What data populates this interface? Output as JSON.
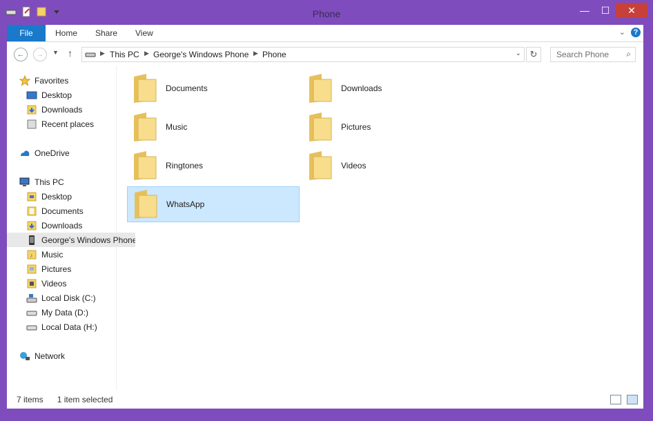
{
  "window": {
    "title": "Phone"
  },
  "ribbon": {
    "tabs": [
      "File",
      "Home",
      "Share",
      "View"
    ],
    "help": "?"
  },
  "address": {
    "segments": [
      "This PC",
      "George's Windows Phone",
      "Phone"
    ]
  },
  "search": {
    "placeholder": "Search Phone"
  },
  "nav": {
    "favorites": "Favorites",
    "fav_items": [
      "Desktop",
      "Downloads",
      "Recent places"
    ],
    "onedrive": "OneDrive",
    "thispc": "This PC",
    "pc_items": [
      "Desktop",
      "Documents",
      "Downloads",
      "George's Windows Phone",
      "Music",
      "Pictures",
      "Videos",
      "Local Disk (C:)",
      "My Data (D:)",
      "Local Data  (H:)"
    ],
    "network": "Network"
  },
  "folders": [
    "Documents",
    "Downloads",
    "Music",
    "Pictures",
    "Ringtones",
    "Videos",
    "WhatsApp"
  ],
  "status": {
    "count": "7 items",
    "selected": "1 item selected"
  },
  "colors": {
    "accent": "#1979ca",
    "title_bar": "#7f4cbd",
    "selection": "#cce8ff"
  }
}
